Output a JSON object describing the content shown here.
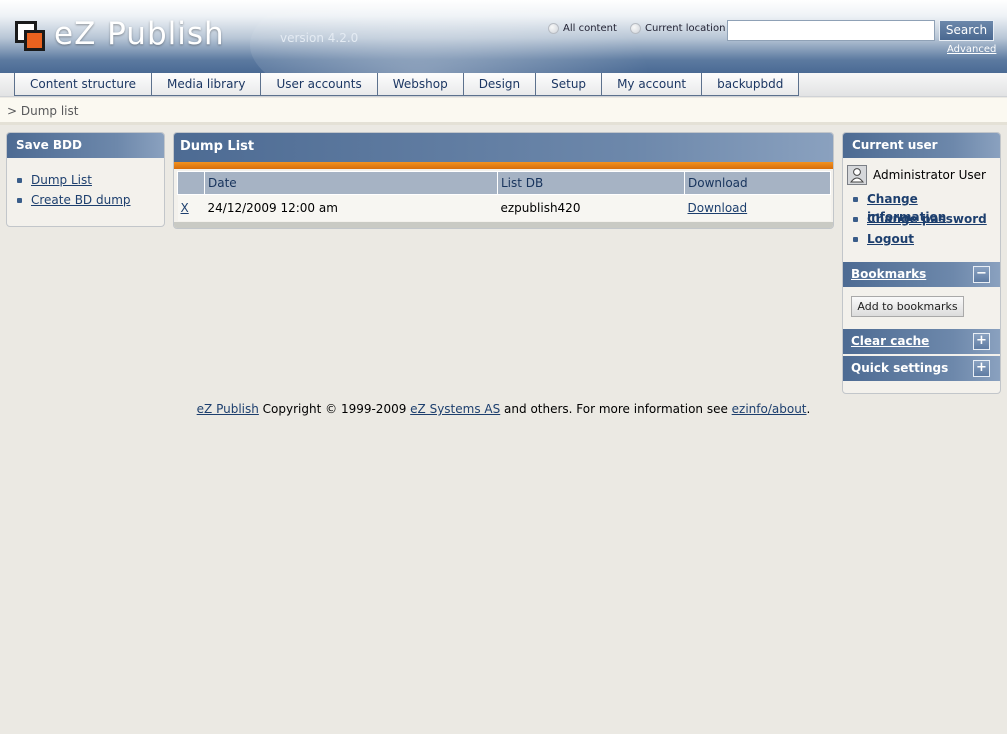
{
  "header": {
    "logo_text": "eZ Publish",
    "version": "version 4.2.0",
    "search": {
      "scope_all": "All content",
      "scope_current": "Current location",
      "input_value": "",
      "button_label": "Search",
      "advanced_link": "Advanced"
    }
  },
  "tabs": [
    {
      "label": "Content structure"
    },
    {
      "label": "Media library"
    },
    {
      "label": "User accounts"
    },
    {
      "label": "Webshop"
    },
    {
      "label": "Design"
    },
    {
      "label": "Setup"
    },
    {
      "label": "My account"
    },
    {
      "label": "backupbdd"
    }
  ],
  "path": "> Dump list",
  "left_box": {
    "title": "Save BDD",
    "links": [
      {
        "label": "Dump List"
      },
      {
        "label": "Create BD dump"
      }
    ]
  },
  "main": {
    "title": "Dump List",
    "columns": [
      "Date",
      "List DB",
      "Download"
    ],
    "rows": [
      {
        "remove": "X",
        "date": "24/12/2009 12:00 am",
        "db": "ezpublish420",
        "download": "Download"
      }
    ]
  },
  "right": {
    "current_user_title": "Current user",
    "user_name": "Administrator User",
    "user_links": [
      {
        "label": "Change information"
      },
      {
        "label": "Change password"
      },
      {
        "label": "Logout"
      }
    ],
    "bookmarks_title": "Bookmarks",
    "bookmarks_toggle": "−",
    "add_bookmark_label": "Add to bookmarks",
    "clear_cache_title": "Clear cache",
    "clear_cache_toggle": "+",
    "quick_settings_title": "Quick settings",
    "quick_settings_toggle": "+"
  },
  "footer": {
    "ez_publish_link": "eZ Publish",
    "copyright_text": " Copyright © 1999-2009 ",
    "ez_systems_link": "eZ Systems AS",
    "more_text": " and others. For more information see ",
    "ezinfo_link": "ezinfo/about",
    "period": "."
  },
  "colors": {
    "brand_blue": "#4d6b93",
    "accent_orange": "#f29220",
    "background": "#ebe9e3"
  }
}
